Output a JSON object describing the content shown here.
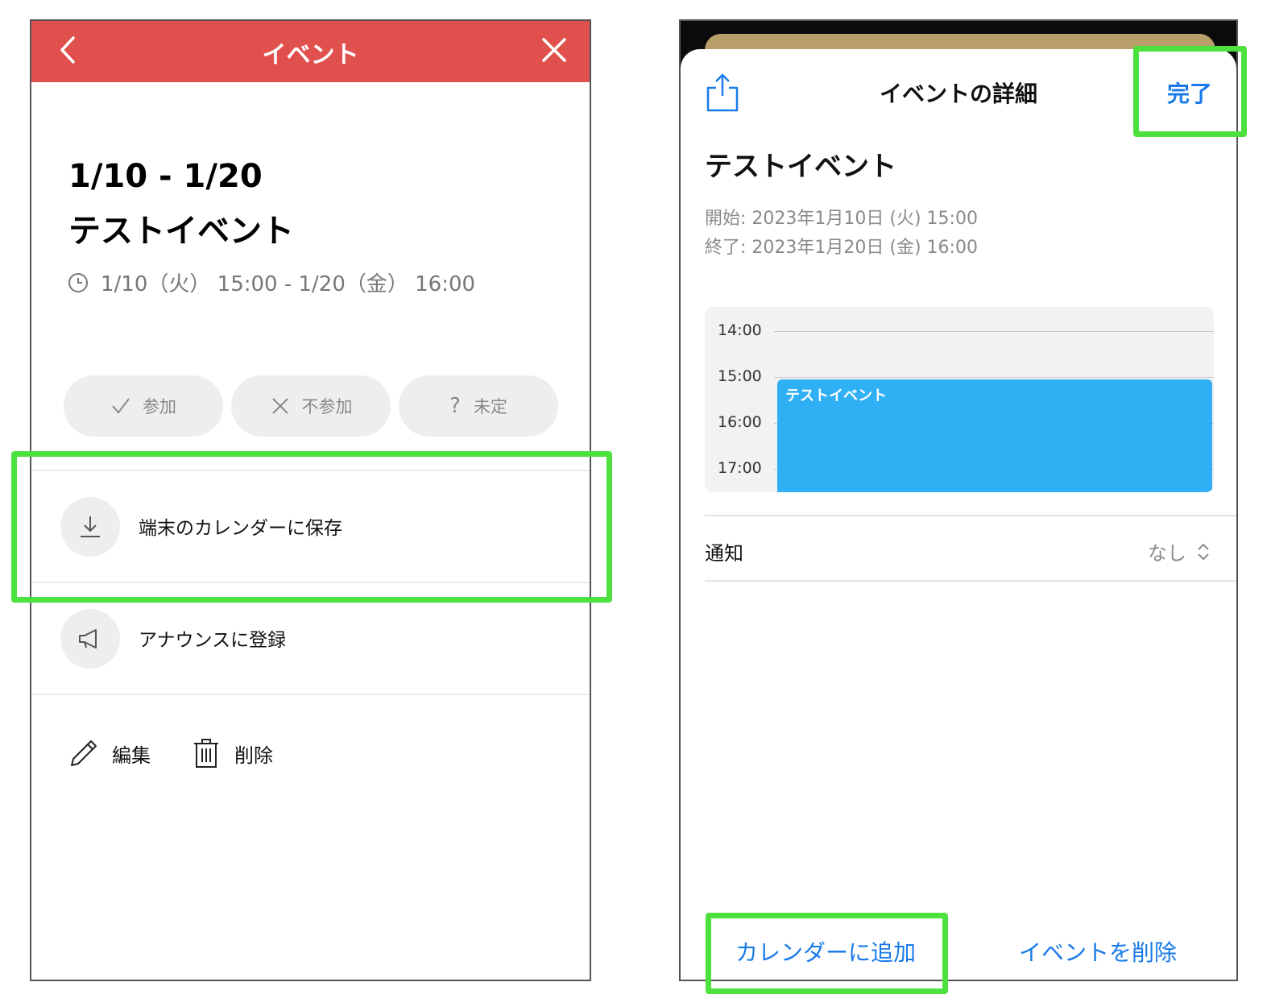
{
  "left": {
    "header": {
      "title": "イベント",
      "color": "#e0504c"
    },
    "event": {
      "dates": "1/10 - 1/20",
      "name": "テストイベント",
      "time": "1/10（火） 15:00 - 1/20（金） 16:00"
    },
    "rsvp": {
      "attend": "参加",
      "decline": "不参加",
      "undecided": "未定",
      "undecided_glyph": "?"
    },
    "menu": {
      "save": "端末のカレンダーに保存",
      "announce": "アナウンスに登録"
    },
    "actions": {
      "edit": "編集",
      "delete": "削除"
    }
  },
  "right": {
    "sheet": {
      "title": "イベントの詳細",
      "done": "完了"
    },
    "event": {
      "name": "テストイベント",
      "start": "開始: 2023年1月10日 (火) 15:00",
      "end": "終了: 2023年1月20日 (金) 16:00"
    },
    "calendar": {
      "times": [
        "14:00",
        "15:00",
        "16:00",
        "17:00"
      ],
      "event_title": "テストイベント",
      "event_color": "#2fb0f4"
    },
    "notification": {
      "label": "通知",
      "value": "なし"
    },
    "footer": {
      "add_to_calendar": "カレンダーに追加",
      "delete_event": "イベントを削除"
    },
    "accent_color": "#1a7be8"
  },
  "highlight_color": "#4de13f"
}
